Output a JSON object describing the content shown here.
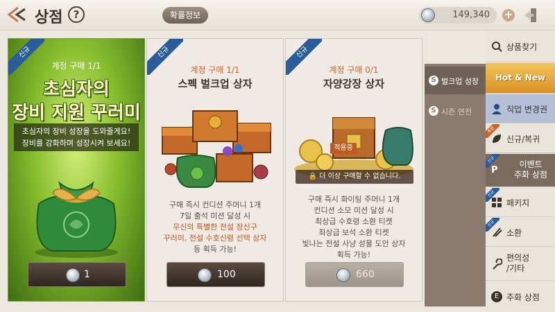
{
  "header": {
    "title": "상점",
    "help_label": "?",
    "prob_info_label": "확률정보",
    "currency_value": "149,340",
    "plus_label": "+"
  },
  "cards": [
    {
      "badge": "신규",
      "limit": "계정 구매 1/1",
      "title_line1": "초심자의",
      "title_line2": "장비 지원 꾸러미",
      "desc_line1": "초심자의 장비 성장을 도와줄게요!",
      "desc_line2": "장비를 강화하며 성장시켜 보세요!",
      "price": "1"
    },
    {
      "badge": "신규",
      "limit": "계정 구매 1/1",
      "title": "스펙 벌크업 상자",
      "desc_line1": "구매 즉시 컨디션 주머니 1개",
      "desc_line2": "7일 출석 미션 달성 시",
      "desc_line3": "무신의 특별한 전설 장신구",
      "desc_line4": "꾸러미, 전설 수호신령 선택 상자",
      "desc_line5": "등 획득 가능!",
      "price": "100"
    },
    {
      "badge": "신규",
      "limit": "계정 구매 0/1",
      "title": "자양강장 상자",
      "active_tag": "적용중",
      "soldout": "더 이상 구매할 수 없습니다.",
      "desc_line1": "구매 즉시 화이팅 주머니 1개",
      "desc_line2": "컨디션 소모 미션 달성 시",
      "desc_line3": "최상급 수호령 소환 티켓",
      "desc_line4": "최상급 보석 소환 티켓",
      "desc_line5": "빛나는 전설 사냥 성물 도안 상자",
      "desc_line6": "획득 가능!",
      "price": "660"
    }
  ],
  "subpanel": [
    {
      "icon": "S",
      "label": "벌크업 성장"
    },
    {
      "icon": "S",
      "label": "시즌 연전"
    }
  ],
  "sidebar": {
    "search": "상품찾기",
    "hot": "Hot & New",
    "job": "직업 변경권",
    "new_return": "신규/복귀",
    "new_return_badge": "추천",
    "event_line1": "이벤트",
    "event_line2": "주화 상점",
    "event_badge": "신규",
    "package": "패키지",
    "package_badge": "신규",
    "summon": "소환",
    "summon_badge": "신규",
    "convenience_line1": "편의성",
    "convenience_line2": "/기타",
    "coin_shop": "주화 상점"
  },
  "colors": {
    "ribbon_blue": "#2a5c9a",
    "highlight_orange": "#c0531c",
    "hot_gold": "#e6a63a"
  }
}
